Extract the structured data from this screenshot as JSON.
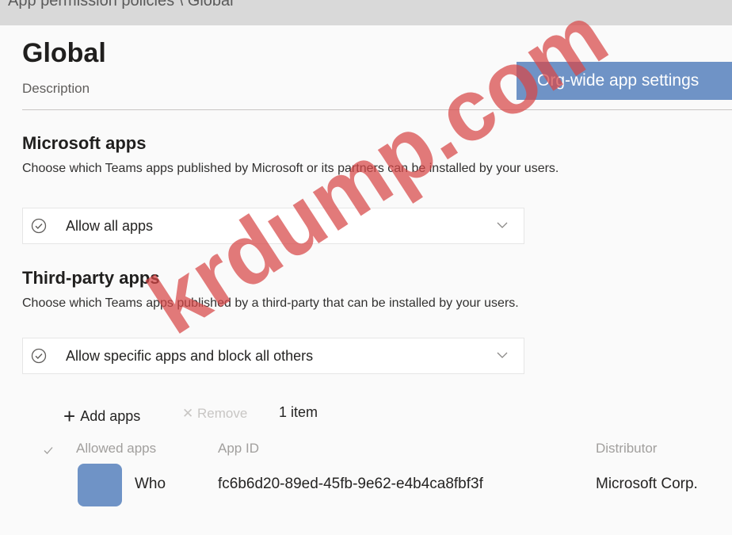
{
  "breadcrumb": "App permission policies \\ Global",
  "header": {
    "title": "Global",
    "description": "Description",
    "org_settings_button": "Org-wide app settings"
  },
  "microsoft_apps": {
    "title": "Microsoft apps",
    "description": "Choose which Teams apps published by Microsoft or its partners can be installed by your users.",
    "selected_option": "Allow all apps"
  },
  "third_party_apps": {
    "title": "Third-party apps",
    "description": "Choose which Teams apps published by a third-party that can be installed by your users.",
    "selected_option": "Allow specific apps and block all others"
  },
  "toolbar": {
    "add_label": "Add apps",
    "remove_label": "Remove",
    "count_label": "1 item"
  },
  "table": {
    "columns": [
      "Allowed apps",
      "App ID",
      "Distributor"
    ],
    "rows": [
      {
        "name": "Who",
        "app_id": "fc6b6d20-89ed-45fb-9e62-e4b4ca8fbf3f",
        "distributor": "Microsoft Corp."
      }
    ]
  },
  "watermark": "krdump.com",
  "icons": {
    "dropdown_check": "circle-check-icon",
    "dropdown_chevron": "chevron-down-icon",
    "add": "plus-icon",
    "remove": "close-icon"
  },
  "colors": {
    "accent": "#6f93c6",
    "watermark": "#d74646"
  }
}
